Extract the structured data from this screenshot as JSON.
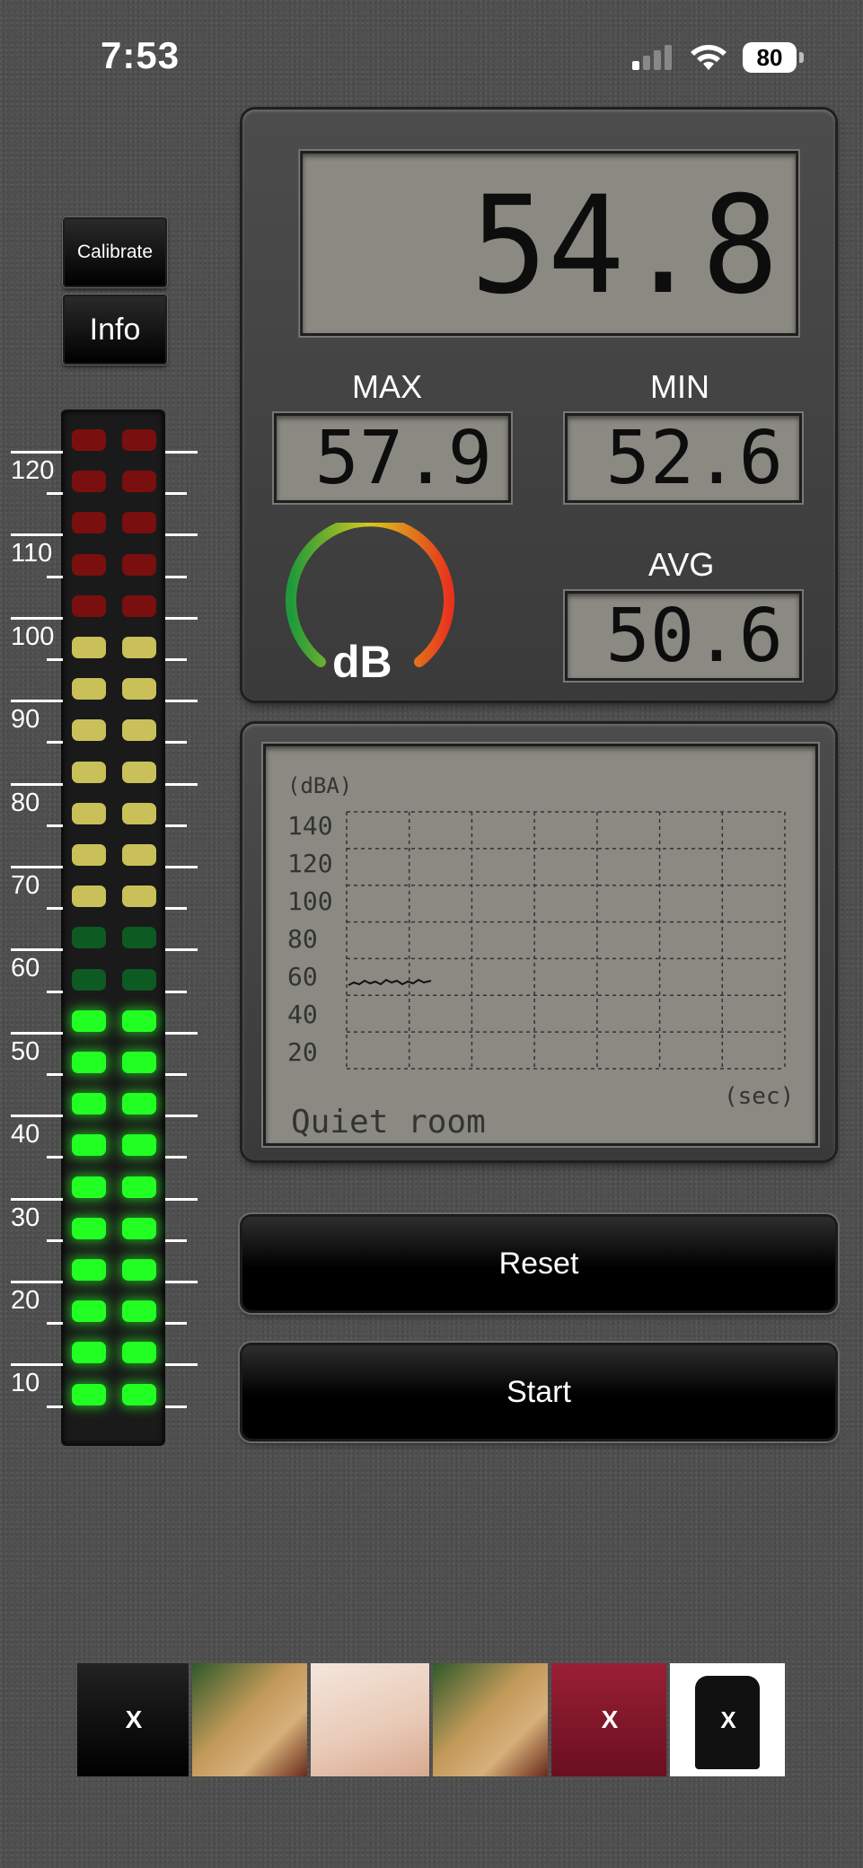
{
  "status_bar": {
    "time": "7:53",
    "battery": "80"
  },
  "left_panel": {
    "calibrate_label": "Calibrate",
    "info_label": "Info"
  },
  "meter_scale": [
    "120",
    "110",
    "100",
    "90",
    "80",
    "70",
    "60",
    "50",
    "40",
    "30",
    "20",
    "10"
  ],
  "meter_levels": {
    "lit_green_rows": 10,
    "level_db": 54.8
  },
  "display": {
    "current": "54.8",
    "max_label": "MAX",
    "max_value": "57.9",
    "min_label": "MIN",
    "min_value": "52.6",
    "avg_label": "AVG",
    "avg_value": "50.6",
    "gauge_label": "dB"
  },
  "graph": {
    "unit_top": "(dBA)",
    "y_ticks": [
      "140",
      "120",
      "100",
      "80",
      "60",
      "40",
      "20"
    ],
    "unit_x": "(sec)",
    "status": "Quiet room"
  },
  "buttons": {
    "reset_label": "Reset",
    "start_label": "Start"
  },
  "colors": {
    "led_red": "#7a0f0f",
    "led_yellow": "#c9c05a",
    "led_green_dim": "#0d5a22",
    "led_green_lit": "#22ff22"
  }
}
